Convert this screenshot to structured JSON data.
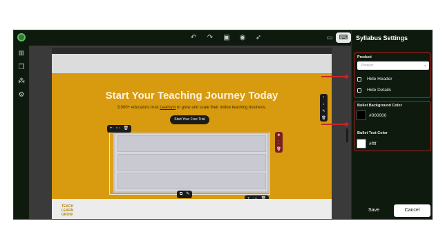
{
  "topbar": {
    "undo_icon": "undo-icon",
    "redo_icon": "redo-icon",
    "save_icon": "save-icon",
    "preview_icon": "eye-icon",
    "publish_icon": "rocket-icon",
    "desktop_icon": "desktop-icon",
    "laptop_icon": "laptop-icon"
  },
  "rail": {
    "icons": [
      "add-icon",
      "pages-icon",
      "blocks-icon",
      "settings-icon"
    ]
  },
  "hero": {
    "title": "Start Your Teaching Journey Today",
    "sub_before": "3,000+ educators trust ",
    "sub_link": "Learnyst",
    "sub_after": " to grow and scale their online teaching business.",
    "cta": "Start Your Free Trial"
  },
  "footer": {
    "logo_line1": "TEACH",
    "logo_line2": "LEARN",
    "logo_line3": "GROW"
  },
  "panel": {
    "title": "Syllabus Settings",
    "product_label": "Product",
    "product_placeholder": "Product",
    "hide_header": "Hide Header",
    "hide_details": "Hide Details",
    "bullet_bg_label": "Bullet Background Color",
    "bullet_bg_value": "#000000",
    "bullet_text_label": "Bullet Text Color",
    "bullet_text_value": "#ffff",
    "save": "Save",
    "cancel": "Cancel"
  },
  "colors": {
    "accent_annotation": "#c62828",
    "hero_bg": "#d89a0f",
    "panel_bg": "#0f1a0f",
    "bullet_bg_swatch": "#000000",
    "bullet_text_swatch": "#ffffff"
  }
}
